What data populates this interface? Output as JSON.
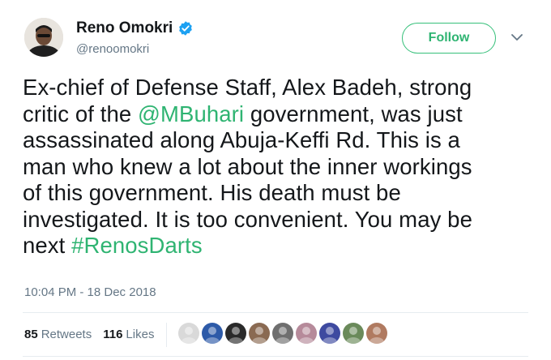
{
  "author": {
    "display_name": "Reno Omokri",
    "handle": "@renoomokri",
    "verified": true
  },
  "follow_button": {
    "label": "Follow"
  },
  "tweet": {
    "lines": [
      [
        {
          "text": "Ex-chief of Defense Staff, Alex Badeh, strong",
          "type": "text"
        }
      ],
      [
        {
          "text": "critic of the ",
          "type": "text"
        },
        {
          "text": "@MBuhari",
          "type": "mention"
        },
        {
          "text": " government, was just",
          "type": "text"
        }
      ],
      [
        {
          "text": "assassinated along Abuja-Keffi Rd. This is a",
          "type": "text"
        }
      ],
      [
        {
          "text": "man who knew a lot about the inner workings",
          "type": "text"
        }
      ],
      [
        {
          "text": "of this government. His death must be",
          "type": "text"
        }
      ],
      [
        {
          "text": "investigated. It is too convenient. You may be",
          "type": "text"
        }
      ],
      [
        {
          "text": "next ",
          "type": "text"
        },
        {
          "text": "#RenosDarts",
          "type": "hashtag"
        }
      ]
    ]
  },
  "timestamp": "10:04 PM - 18 Dec 2018",
  "stats": {
    "retweets_count": "85",
    "retweets_label": "Retweets",
    "likes_count": "116",
    "likes_label": "Likes"
  },
  "colors": {
    "accent": "#2fb472",
    "text": "#14171a",
    "muted": "#657786",
    "verified_badge": "#1da1f2",
    "divider": "#e6ecf0"
  },
  "likers": [
    {
      "icon": "liker-avatar-1",
      "color": "#d9d9d9"
    },
    {
      "icon": "liker-avatar-2",
      "color": "#2d5aa8"
    },
    {
      "icon": "liker-avatar-3",
      "color": "#2a2a2a"
    },
    {
      "icon": "liker-avatar-4",
      "color": "#8a6a52"
    },
    {
      "icon": "liker-avatar-5",
      "color": "#6f6f6f"
    },
    {
      "icon": "liker-avatar-6",
      "color": "#b68a9a"
    },
    {
      "icon": "liker-avatar-7",
      "color": "#3e4aa0"
    },
    {
      "icon": "liker-avatar-8",
      "color": "#6a8a5a"
    },
    {
      "icon": "liker-avatar-9",
      "color": "#b07a60"
    }
  ]
}
